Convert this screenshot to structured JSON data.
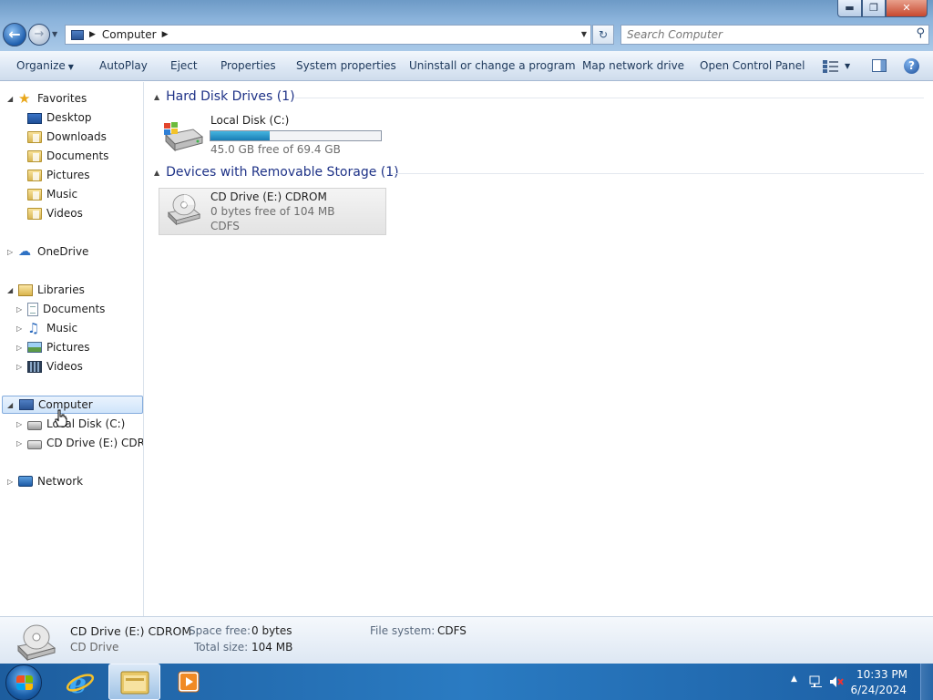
{
  "window": {
    "min_label": "▬",
    "max_label": "❐",
    "close_label": "✕"
  },
  "address": {
    "crumb": "Computer",
    "search_placeholder": "Search Computer"
  },
  "toolbar": {
    "organize": "Organize",
    "autoplay": "AutoPlay",
    "eject": "Eject",
    "properties": "Properties",
    "system_properties": "System properties",
    "uninstall": "Uninstall or change a program",
    "map_drive": "Map network drive",
    "control_panel": "Open Control Panel"
  },
  "nav": {
    "favorites": "Favorites",
    "desktop": "Desktop",
    "downloads": "Downloads",
    "documents": "Documents",
    "pictures": "Pictures",
    "music": "Music",
    "videos": "Videos",
    "onedrive": "OneDrive",
    "libraries": "Libraries",
    "lib_documents": "Documents",
    "lib_music": "Music",
    "lib_pictures": "Pictures",
    "lib_videos": "Videos",
    "computer": "Computer",
    "local_disk": "Local Disk (C:)",
    "cd_drive": "CD Drive (E:) CDROM",
    "network": "Network"
  },
  "content": {
    "hdd_group": "Hard Disk Drives (1)",
    "removable_group": "Devices with Removable Storage (1)",
    "local_disk": {
      "name": "Local Disk (C:)",
      "free": "45.0 GB free of 69.4 GB",
      "used_fraction": 0.35
    },
    "cd_drive": {
      "name": "CD Drive (E:) CDROM",
      "free": "0 bytes free of 104 MB",
      "fs": "CDFS"
    }
  },
  "details": {
    "name": "CD Drive (E:) CDROM",
    "type": "CD Drive",
    "space_free_label": "Space free:",
    "space_free": "0 bytes",
    "total_size_label": "Total size:",
    "total_size": "104 MB",
    "fs_label": "File system:",
    "fs": "CDFS"
  },
  "taskbar": {
    "time": "10:33 PM",
    "date": "6/24/2024"
  },
  "colors": {
    "accent": "#1e3287",
    "capacity_fill": "#26a0da",
    "taskbar": "#2a7bc2"
  }
}
